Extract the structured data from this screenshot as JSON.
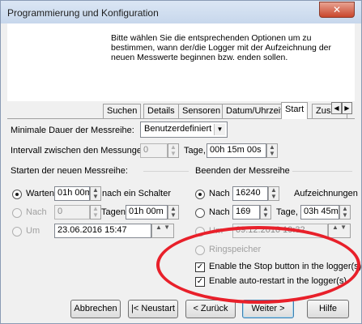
{
  "window": {
    "title": "Programmierung und Konfiguration",
    "close_icon": "close-icon"
  },
  "header": {
    "description": "Bitte wählen Sie die entsprechenden Optionen um zu bestimmen, wann der/die Logger mit der Aufzeichnung der neuen Messwerte beginnen bzw. enden sollen."
  },
  "tabs": [
    "Suchen",
    "Details",
    "Sensoren",
    "Datum/Uhrzeit",
    "Start",
    "Zusamm"
  ],
  "active_tab": "Start",
  "form": {
    "min_duration_label": "Minimale Dauer der Messreihe:",
    "min_duration_value": "Benutzerdefiniert",
    "interval_label": "Intervall zwischen den Messungen:",
    "interval_days": "0",
    "interval_days_unit": "Tage,",
    "interval_time": "00h 15m 00s",
    "start_group": "Starten der neuen Messreihe:",
    "end_group": "Beenden der Messreihe",
    "start_wait_label": "Warten",
    "start_wait_value": "01h 00m",
    "start_wait_suffix": "nach ein Schalter",
    "start_after_label": "Nach",
    "start_after_days": "0",
    "start_after_unit": "Tagen,",
    "start_after_time": "01h 00m",
    "start_at_label": "Um",
    "start_at_value": "23.06.2016 15:47",
    "end_after_label": "Nach",
    "end_after_value": "16240",
    "end_after_suffix": "Aufzeichnungen",
    "end_after2_label": "Nach",
    "end_after2_days": "169",
    "end_after2_unit": "Tage,",
    "end_after2_time": "03h 45m",
    "end_at_label": "Um",
    "end_at_value": "09.12.2016 19:32",
    "ring_label": "Ringspeicher",
    "stop_button_check": "Enable the Stop button in the logger(s).",
    "auto_restart_check": "Enable auto-restart in the logger(s)."
  },
  "buttons": {
    "cancel": "Abbrechen",
    "restart": "|< Neustart",
    "back": "< Zurück",
    "next": "Weiter >",
    "help": "Hilfe"
  },
  "colors": {
    "highlight_ellipse": "#e8202a",
    "close_button": "#c9462c"
  }
}
